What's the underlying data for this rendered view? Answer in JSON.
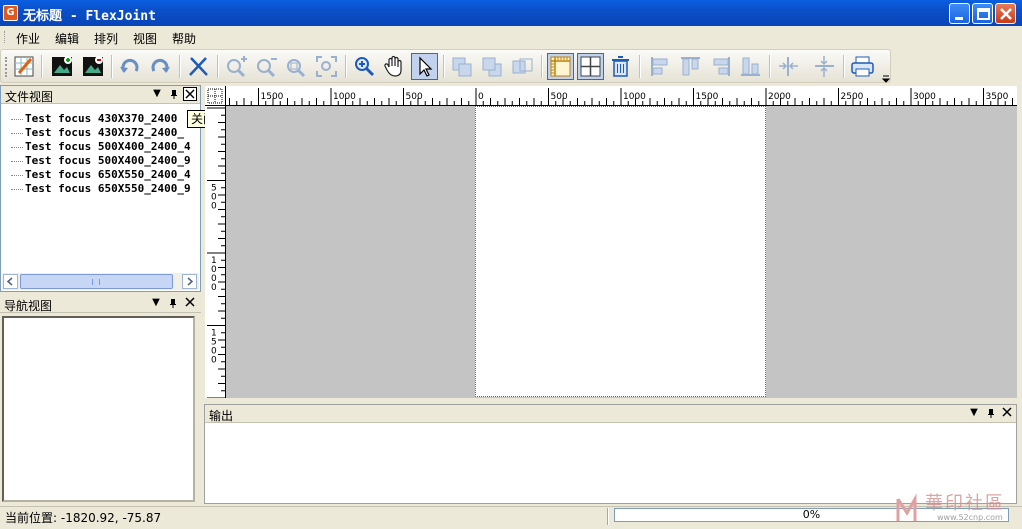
{
  "window": {
    "title": "无标题 - FlexJoint",
    "app_icon": "G"
  },
  "menu": [
    "作业",
    "编辑",
    "排列",
    "视图",
    "帮助"
  ],
  "toolbar": {
    "icons": [
      "new-job-icon",
      "add-image-icon",
      "image-icon",
      "undo-icon",
      "redo-icon",
      "cut-icon",
      "zoom-in-icon",
      "zoom-out-icon",
      "zoom-fit-icon",
      "zoom-fullscreen-icon",
      "zoom-tool-icon",
      "pan-hand-icon",
      "select-arrow-icon",
      "align-1-icon",
      "align-2-icon",
      "align-3-icon",
      "ruler-icon",
      "grid-icon",
      "delete-icon",
      "align-left-icon",
      "align-top-icon",
      "align-right-icon",
      "align-bottom-icon",
      "distribute-h-icon",
      "distribute-v-icon",
      "print-icon"
    ]
  },
  "file_panel": {
    "title": "文件视图",
    "items": [
      "Test focus 430X370_2400",
      "Test focus 430X372_2400_",
      "Test focus 500X400_2400_4",
      "Test focus 500X400_2400_9",
      "Test focus 650X550_2400_4",
      "Test focus 650X550_2400_9"
    ]
  },
  "tooltip": "关闭",
  "nav_panel": {
    "title": "导航视图"
  },
  "output_panel": {
    "title": "输出"
  },
  "ruler": {
    "h_labels": [
      "1500",
      "1000",
      "500",
      "0",
      "500",
      "1000",
      "1500",
      "2000",
      "2500",
      "3000",
      "3500"
    ],
    "v_labels": [
      "500",
      "1000",
      "1500"
    ]
  },
  "status": {
    "position": "当前位置: -1820.92, -75.87",
    "progress_text": "0%",
    "progress": 0
  },
  "watermark": {
    "text": "華印社區",
    "url": "www.52cnp.com"
  },
  "colors": {
    "titlebar": "#0b54d6",
    "canvas": "#c4c4c4",
    "selected_tool": "#c1d2ee"
  }
}
